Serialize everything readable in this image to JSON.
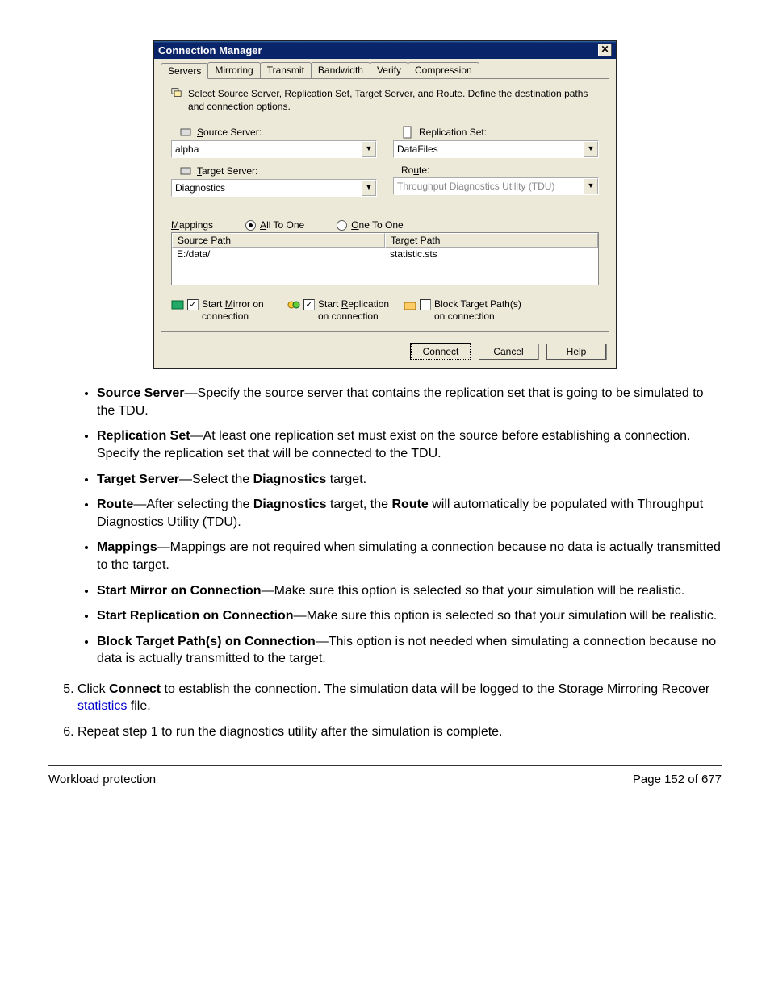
{
  "dialog": {
    "title": "Connection Manager",
    "tabs": [
      "Servers",
      "Mirroring",
      "Transmit",
      "Bandwidth",
      "Verify",
      "Compression"
    ],
    "help_text": "Select Source Server, Replication Set, Target Server, and Route.  Define the destination paths and connection options.",
    "source_label": "Source Server:",
    "source_value": "alpha",
    "repset_label": "Replication Set:",
    "repset_value": "DataFiles",
    "target_label": "Target Server:",
    "target_value": "Diagnostics",
    "route_label": "Route:",
    "route_value": "Throughput Diagnostics Utility (TDU)",
    "mappings_label": "Mappings",
    "radio_all": "All To One",
    "radio_one": "One To One",
    "col_source": "Source Path",
    "col_target": "Target Path",
    "row_source": "E:/data/",
    "row_target": "statistic.sts",
    "chk_mirror": "Start Mirror on connection",
    "chk_repl": "Start Replication on connection",
    "chk_block": "Block Target Path(s) on connection",
    "btn_connect": "Connect",
    "btn_cancel": "Cancel",
    "btn_help": "Help"
  },
  "bullets": {
    "b1_term": "Source Server",
    "b1_text": "—Specify the source server that contains the replication set that is going to be simulated to the TDU.",
    "b2_term": "Replication Set",
    "b2_text": "—At least one replication set must exist on the source before establishing a connection. Specify the replication set that will be connected to the TDU.",
    "b3_term": "Target Server",
    "b3_text1": "—Select the ",
    "b3_bold": "Diagnostics",
    "b3_text2": " target.",
    "b4_term": "Route",
    "b4_text1": "—After selecting the ",
    "b4_bold1": "Diagnostics",
    "b4_text2": " target, the ",
    "b4_bold2": "Route",
    "b4_text3": " will automatically be populated with Throughput Diagnostics Utility (TDU).",
    "b5_term": "Mappings",
    "b5_text": "—Mappings are not required when simulating a connection because no data is actually transmitted to the target.",
    "b6_term": "Start Mirror on Connection",
    "b6_text": "—Make sure this option is selected so that your simulation will be realistic.",
    "b7_term": "Start Replication on Connection",
    "b7_text": "—Make sure this option is selected so that your simulation will be realistic.",
    "b8_term": "Block Target Path(s) on Connection",
    "b8_text": "—This option is not needed when simulating a connection because no data is actually transmitted to the target."
  },
  "steps": {
    "s5a": "Click ",
    "s5bold": "Connect",
    "s5b": " to establish the connection. The simulation data will be logged to the Storage Mirroring Recover ",
    "s5link": "statistics",
    "s5c": " file.",
    "s6": "Repeat step 1 to run the diagnostics utility after the simulation is complete."
  },
  "footer": {
    "left": "Workload protection",
    "right": "Page 152 of 677"
  }
}
